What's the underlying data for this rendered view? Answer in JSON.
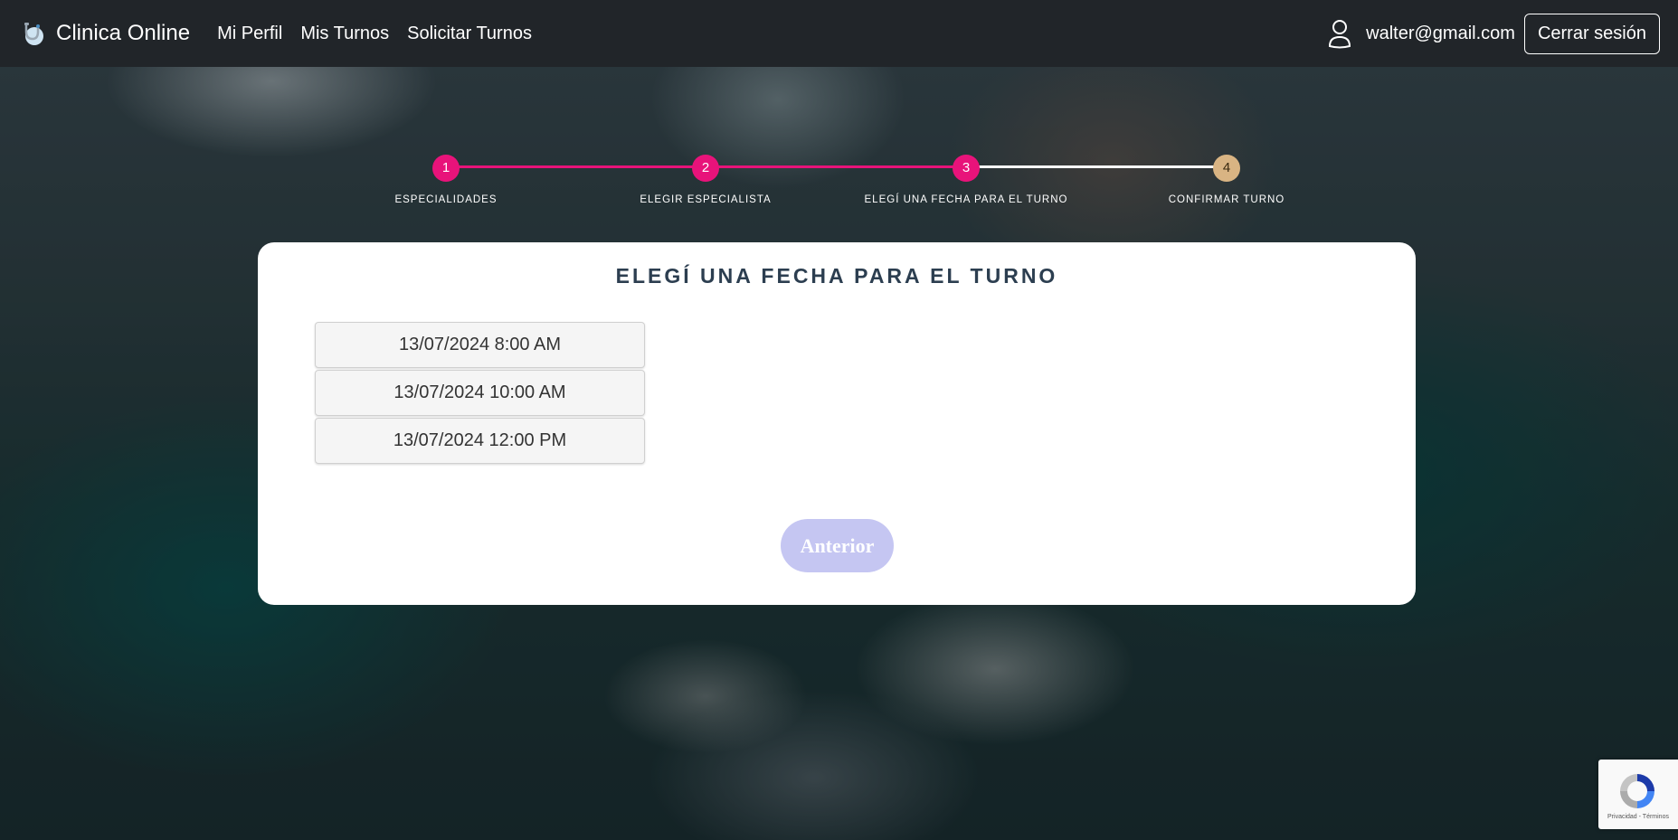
{
  "navbar": {
    "brand": "Clinica Online",
    "links": [
      "Mi Perfil",
      "Mis Turnos",
      "Solicitar Turnos"
    ],
    "user_email": "walter@gmail.com",
    "logout_label": "Cerrar sesión"
  },
  "stepper": {
    "steps": [
      {
        "number": "1",
        "label": "ESPECIALIDADES"
      },
      {
        "number": "2",
        "label": "ELEGIR ESPECIALISTA"
      },
      {
        "number": "3",
        "label": "ELEGÍ UNA FECHA PARA EL TURNO"
      },
      {
        "number": "4",
        "label": "CONFIRMAR TURNO"
      }
    ],
    "active_color": "#e8137a",
    "pending_color": "#d9b483",
    "pending_line_color": "#ffffff"
  },
  "card": {
    "title": "ELEGÍ UNA FECHA PARA EL TURNO",
    "slots": [
      "13/07/2024 8:00 AM",
      "13/07/2024 10:00 AM",
      "13/07/2024 12:00 PM"
    ],
    "prev_label": "Anterior"
  },
  "recaptcha": {
    "text": "Privacidad - Términos"
  }
}
